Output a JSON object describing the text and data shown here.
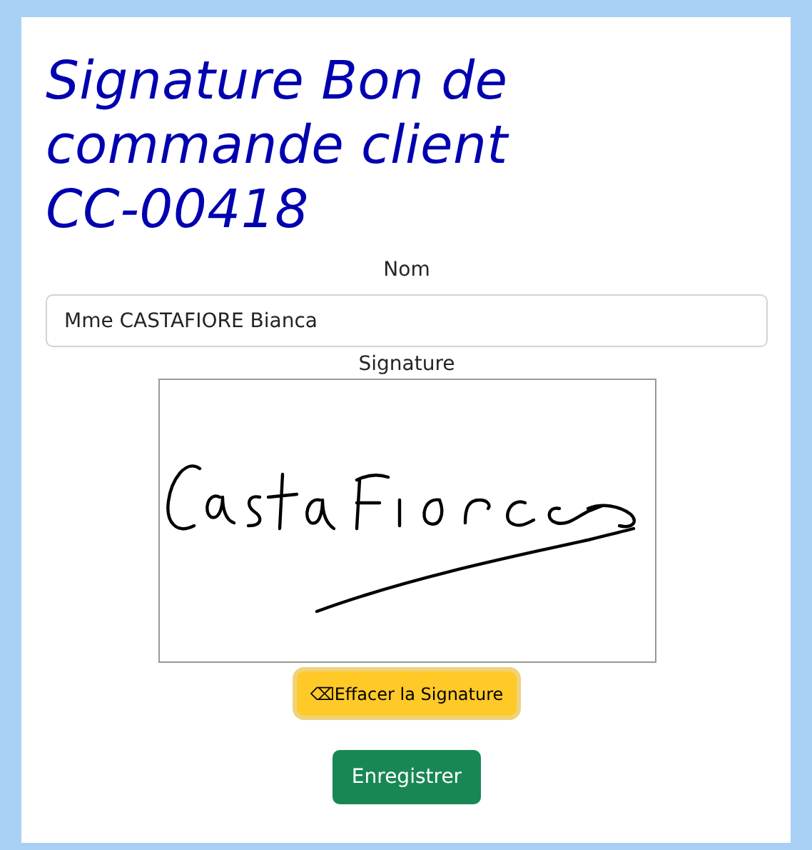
{
  "title": "Signature Bon de commande client CC-00418",
  "name_field": {
    "label": "Nom",
    "value": "Mme CASTAFIORE Bianca"
  },
  "signature": {
    "label": "Signature"
  },
  "clear_button": {
    "label": "⌫Effacer la Signature",
    "focused": true
  },
  "save_button": {
    "label": "Enregistrer"
  }
}
